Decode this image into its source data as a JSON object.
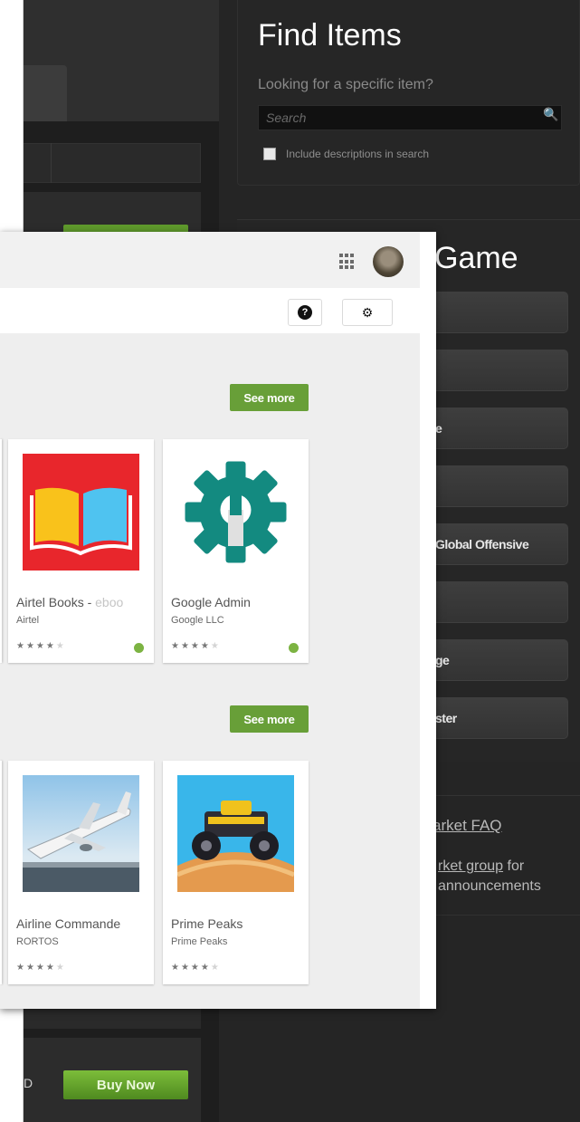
{
  "find_items": {
    "title": "Find Items",
    "subtitle": "Looking for a specific item?",
    "search_placeholder": "Search",
    "include_descriptions": "Include descriptions in search"
  },
  "browse_game": {
    "title_fragment": "Game",
    "buttons": [
      "",
      "",
      "e",
      "",
      "Global Offensive",
      "",
      "ge",
      "ster"
    ]
  },
  "links": {
    "faq": "arket FAQ",
    "group_link": "rket group",
    "group_suffix": " for",
    "announcements": "announcements"
  },
  "listing": {
    "price_fragment": "D",
    "buy_now": "Buy Now"
  },
  "playstore": {
    "see_more": "See more",
    "sections": [
      {
        "cards": [
          {
            "title": "Airtel Books - ",
            "title_faded": "eboo",
            "developer": "Airtel",
            "rating_on": 4,
            "rating_off": 1,
            "badge": true
          },
          {
            "title": "Google Admin",
            "title_faded": "",
            "developer": "Google LLC",
            "rating_on": 3.5,
            "rating_off": 1.5,
            "badge": true
          }
        ]
      },
      {
        "cards": [
          {
            "title": "Airline Commande",
            "title_faded": "",
            "developer": "RORTOS",
            "rating_on": 4,
            "rating_off": 1,
            "badge": false
          },
          {
            "title": "Prime Peaks",
            "title_faded": "",
            "developer": "Prime Peaks",
            "rating_on": 4.5,
            "rating_off": 0.5,
            "badge": false
          }
        ]
      }
    ]
  },
  "colors": {
    "see_more_green": "#689f38",
    "steam_buy_green": "#5f9a2c",
    "airtel_red": "#e8262c"
  }
}
